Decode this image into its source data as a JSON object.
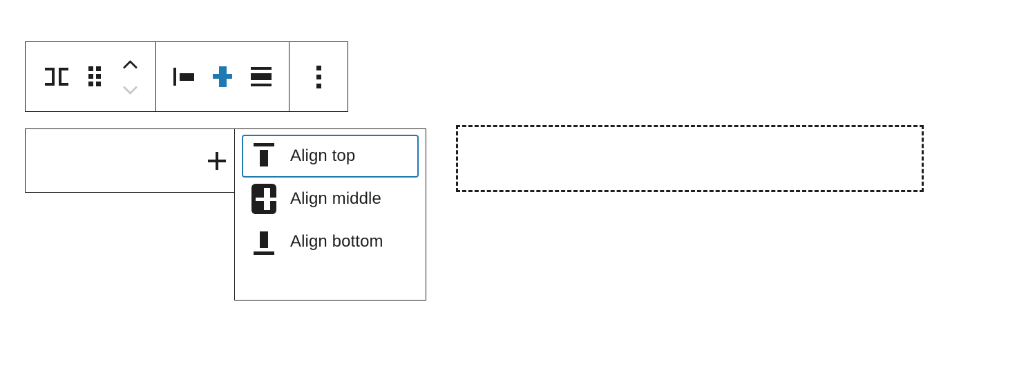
{
  "theme": {
    "accent": "#1e7ab0",
    "ink": "#1e1e1e",
    "disabled": "#c7c7c7",
    "surface": "#ffffff"
  },
  "toolbar": {
    "name": "block-toolbar",
    "groups": [
      {
        "name": "block-controls",
        "buttons": [
          {
            "name": "block-type-row",
            "icon": "row-block-icon",
            "label": "Row",
            "state": "default"
          },
          {
            "name": "drag-handle",
            "icon": "drag-handle-icon",
            "label": "Drag",
            "state": "default"
          },
          {
            "name": "move-up",
            "icon": "chevron-up-icon",
            "label": "Move up",
            "state": "enabled"
          },
          {
            "name": "move-down",
            "icon": "chevron-down-icon",
            "label": "Move down",
            "state": "disabled"
          }
        ]
      },
      {
        "name": "alignment-controls",
        "buttons": [
          {
            "name": "justify-items-left",
            "icon": "justify-left-icon",
            "label": "Justify items left",
            "state": "default"
          },
          {
            "name": "change-vertical-alignment",
            "icon": "align-middle-plus-icon",
            "label": "Change vertical alignment",
            "state": "active"
          },
          {
            "name": "justify-items-stretch",
            "icon": "stretch-icon",
            "label": "Stretch items",
            "state": "default"
          }
        ]
      },
      {
        "name": "more-controls",
        "buttons": [
          {
            "name": "options",
            "icon": "ellipsis-vertical-icon",
            "label": "Options",
            "state": "default"
          }
        ]
      }
    ]
  },
  "block_area": {
    "name": "empty-row-block",
    "appender": {
      "name": "add-block-button",
      "icon": "plus-icon",
      "label": "Add block"
    }
  },
  "dropdown": {
    "name": "vertical-alignment-menu",
    "items": [
      {
        "label": "Align top",
        "icon": "align-top-icon",
        "state": "focused",
        "selected": false
      },
      {
        "label": "Align middle",
        "icon": "align-middle-icon",
        "state": "selected",
        "selected": true
      },
      {
        "label": "Align bottom",
        "icon": "align-bottom-icon",
        "state": "default",
        "selected": false
      }
    ]
  },
  "placeholder": {
    "name": "dashed-drop-zone",
    "text": ""
  }
}
